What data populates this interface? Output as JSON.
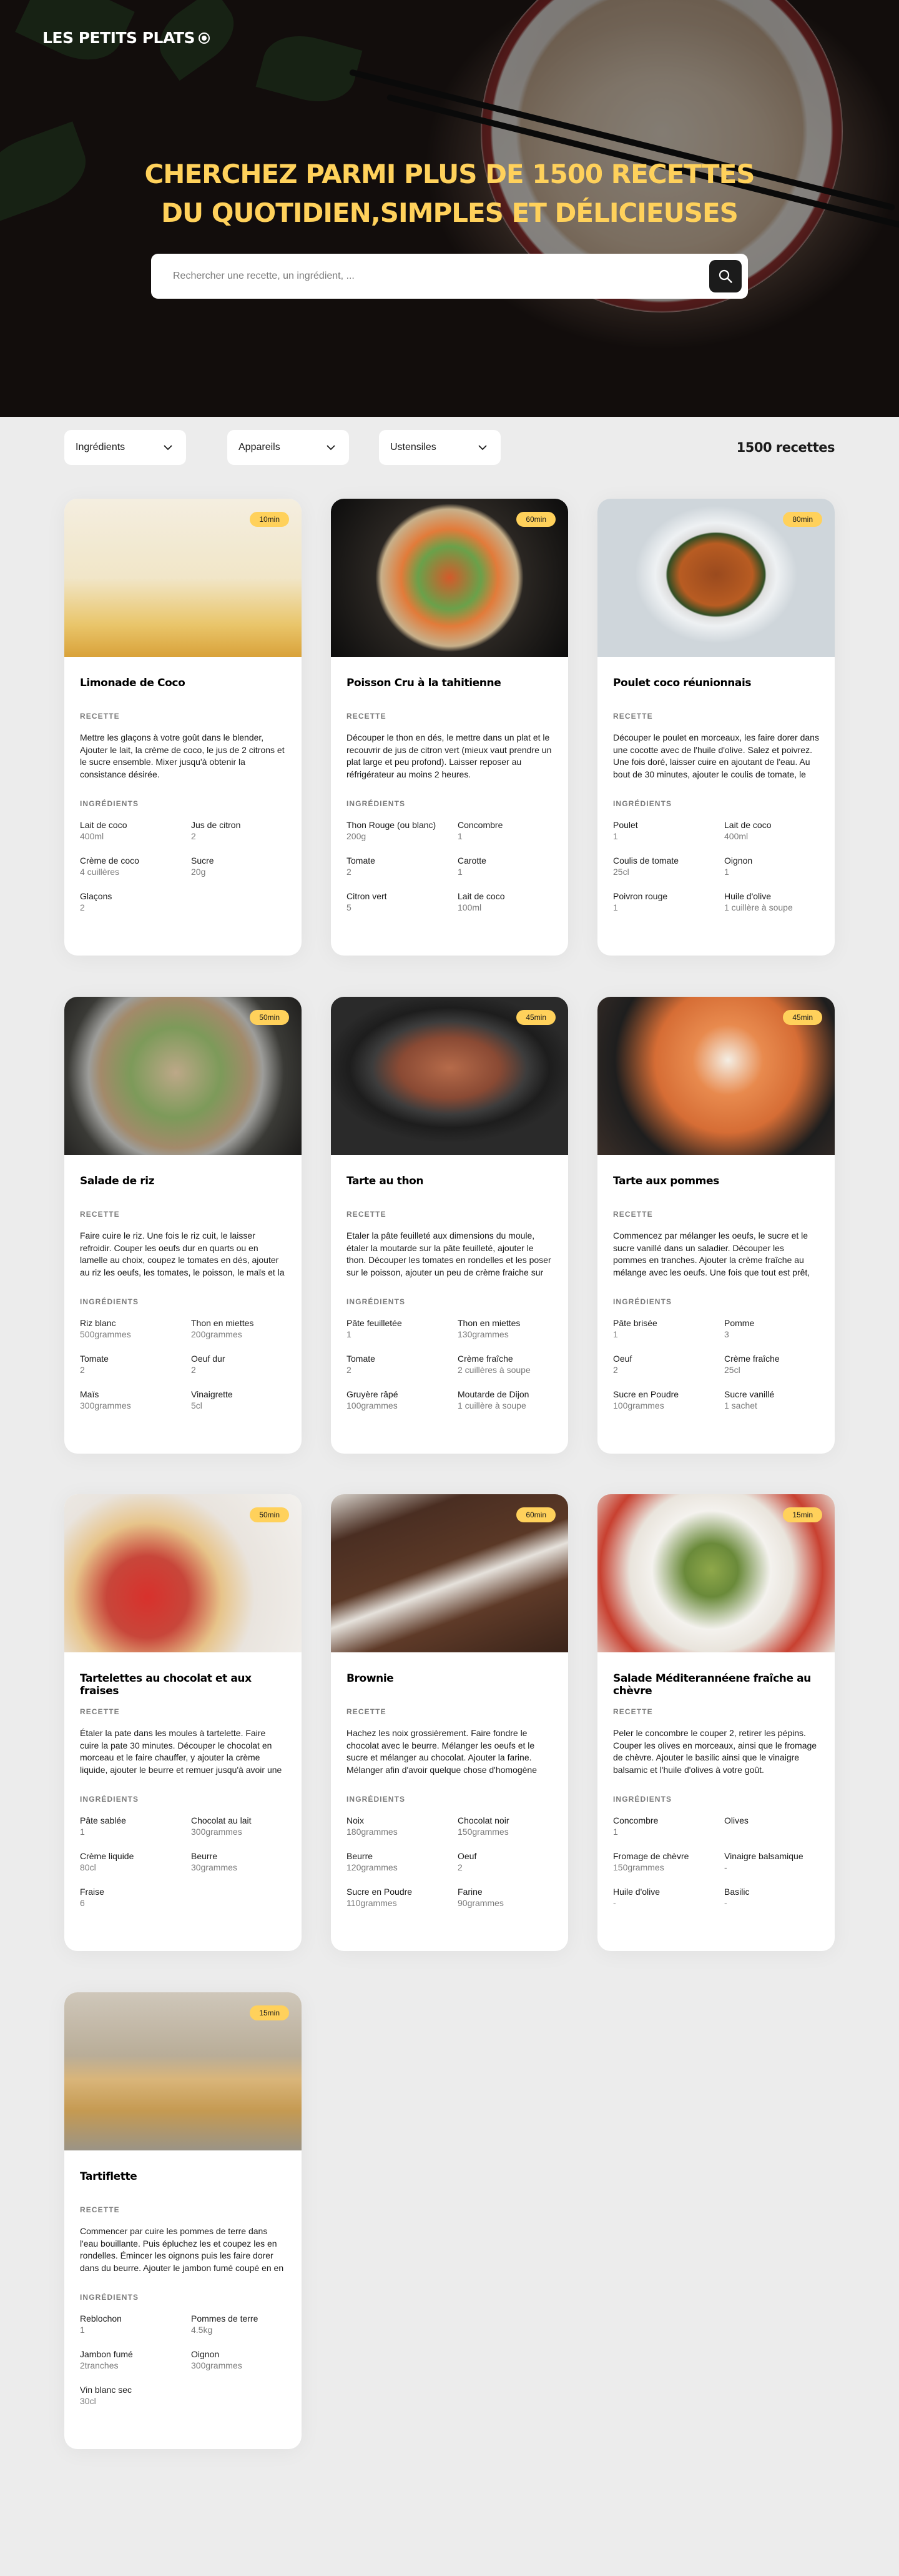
{
  "header": {
    "logo": "LES PETITS PLATS",
    "headline_1": "CHERCHEZ PARMI PLUS DE 1500 RECETTES",
    "headline_2": "DU QUOTIDIEN,SIMPLES ET DÉLICIEUSES",
    "search_placeholder": "Rechercher une recette, un ingrédient, ..."
  },
  "filters": {
    "ingredients": "Ingrédients",
    "appareils": "Appareils",
    "ustensiles": "Ustensiles",
    "count": "1500 recettes"
  },
  "labels": {
    "recette": "RECETTE",
    "ingredients": "INGRÉDIENTS"
  },
  "recipes": [
    {
      "time": "10min",
      "title": "Limonade de Coco",
      "description": "Mettre les glaçons à votre goût dans le blender, Ajouter le lait, la crème de coco, le jus de 2 citrons et le sucre ensemble. Mixer jusqu'à obtenir la consistance désirée.",
      "ingredients": [
        {
          "name": "Lait de coco",
          "qty": "400ml"
        },
        {
          "name": "Jus de citron",
          "qty": "2"
        },
        {
          "name": "Crème de coco",
          "qty": "4 cuillères"
        },
        {
          "name": "Sucre",
          "qty": "20g"
        },
        {
          "name": "Glaçons",
          "qty": "2"
        }
      ]
    },
    {
      "time": "60min",
      "title": "Poisson Cru à la tahitienne",
      "description": "Découper le thon en dés, le mettre dans un plat et le recouvrir de jus de citron vert (mieux vaut prendre un plat large et peu profond). Laisser reposer au réfrigérateur au moins 2 heures.",
      "ingredients": [
        {
          "name": "Thon Rouge (ou blanc)",
          "qty": "200g"
        },
        {
          "name": "Concombre",
          "qty": "1"
        },
        {
          "name": "Tomate",
          "qty": "2"
        },
        {
          "name": "Carotte",
          "qty": "1"
        },
        {
          "name": "Citron vert",
          "qty": "5"
        },
        {
          "name": "Lait de coco",
          "qty": "100ml"
        }
      ]
    },
    {
      "time": "80min",
      "title": "Poulet coco réunionnais",
      "description": "Découper le poulet en morceaux, les faire dorer dans une cocotte avec de l'huile d'olive. Salez et poivrez. Une fois doré, laisser cuire en ajoutant de l'eau. Au bout de 30 minutes, ajouter le coulis de tomate, le lait de coco ainsi que le poivron et l'oignon.",
      "ingredients": [
        {
          "name": "Poulet",
          "qty": "1"
        },
        {
          "name": "Lait de coco",
          "qty": "400ml"
        },
        {
          "name": "Coulis de tomate",
          "qty": "25cl"
        },
        {
          "name": "Oignon",
          "qty": "1"
        },
        {
          "name": "Poivron rouge",
          "qty": "1"
        },
        {
          "name": "Huile d'olive",
          "qty": "1 cuillère à soupe"
        }
      ]
    },
    {
      "time": "50min",
      "title": "Salade de riz",
      "description": "Faire cuire le riz. Une fois le riz cuit, le laisser refroidir. Couper les oeufs dur en quarts ou en lamelle au choix, coupez le tomates en dés, ajouter au riz les oeufs, les tomates, le poisson, le maïs et la vinaigrette.",
      "ingredients": [
        {
          "name": "Riz blanc",
          "qty": "500grammes"
        },
        {
          "name": "Thon en miettes",
          "qty": "200grammes"
        },
        {
          "name": "Tomate",
          "qty": "2"
        },
        {
          "name": "Oeuf dur",
          "qty": "2"
        },
        {
          "name": "Maïs",
          "qty": "300grammes"
        },
        {
          "name": "Vinaigrette",
          "qty": "5cl"
        }
      ]
    },
    {
      "time": "45min",
      "title": "Tarte au thon",
      "description": "Etaler la pâte feuilleté aux dimensions du moule, étaler la moutarde sur la pâte feuilleté, ajouter le thon. Découper les tomates en rondelles et les poser sur le poisson, ajouter un peu de crème fraiche sur toute la tarte et recouvrez de gruyère râpé.",
      "ingredients": [
        {
          "name": "Pâte feuilletée",
          "qty": "1"
        },
        {
          "name": "Thon en miettes",
          "qty": "130grammes"
        },
        {
          "name": "Tomate",
          "qty": "2"
        },
        {
          "name": "Crème fraîche",
          "qty": "2 cuillères à soupe"
        },
        {
          "name": "Gruyère râpé",
          "qty": "100grammes"
        },
        {
          "name": "Moutarde de Dijon",
          "qty": "1 cuillère à soupe"
        }
      ]
    },
    {
      "time": "45min",
      "title": "Tarte aux pommes",
      "description": "Commencez par mélanger les oeufs, le sucre et le sucre vanillé dans un saladier. Découper les pommes en tranches. Ajouter la crème fraîche au mélange avec les oeufs. Une fois que tout est prêt, étalez la tarte dans le moule.",
      "ingredients": [
        {
          "name": "Pâte brisée",
          "qty": "1"
        },
        {
          "name": "Pomme",
          "qty": "3"
        },
        {
          "name": "Oeuf",
          "qty": "2"
        },
        {
          "name": "Crème fraîche",
          "qty": "25cl"
        },
        {
          "name": "Sucre en Poudre",
          "qty": "100grammes"
        },
        {
          "name": "Sucre vanillé",
          "qty": "1 sachet"
        }
      ]
    },
    {
      "time": "50min",
      "title": "Tartelettes au chocolat et aux fraises",
      "description": "Étaler la pate dans les moules à tartelette. Faire cuire la pate 30 minutes. Découper le chocolat en morceau et le faire chauffer, y ajouter la crème liquide, ajouter le beurre et remuer jusqu'à avoir une pâte homogène.",
      "ingredients": [
        {
          "name": "Pâte sablée",
          "qty": "1"
        },
        {
          "name": "Chocolat au lait",
          "qty": "300grammes"
        },
        {
          "name": "Crème liquide",
          "qty": "80cl"
        },
        {
          "name": "Beurre",
          "qty": "30grammes"
        },
        {
          "name": "Fraise",
          "qty": "6"
        }
      ]
    },
    {
      "time": "60min",
      "title": "Brownie",
      "description": "Hachez les noix grossièrement. Faire fondre le chocolat avec le beurre. Mélanger les oeufs et le sucre et mélanger au chocolat. Ajouter la farine. Mélanger afin d'avoir quelque chose d'homogène puis incorporer les noix.",
      "ingredients": [
        {
          "name": "Noix",
          "qty": "180grammes"
        },
        {
          "name": "Chocolat noir",
          "qty": "150grammes"
        },
        {
          "name": "Beurre",
          "qty": "120grammes"
        },
        {
          "name": "Oeuf",
          "qty": "2"
        },
        {
          "name": "Sucre en Poudre",
          "qty": "110grammes"
        },
        {
          "name": "Farine",
          "qty": "90grammes"
        }
      ]
    },
    {
      "time": "15min",
      "title": "Salade Méditerannéene fraîche au chèvre",
      "description": "Peler le concombre le couper 2, retirer les pépins. Couper les olives en morceaux, ainsi que le fromage de chèvre. Ajouter le basilic ainsi que le vinaigre balsamic et l'huile d'olives à votre goût.",
      "ingredients": [
        {
          "name": "Concombre",
          "qty": "1"
        },
        {
          "name": "Olives",
          "qty": ""
        },
        {
          "name": "Fromage de chèvre",
          "qty": "150grammes"
        },
        {
          "name": "Vinaigre balsamique",
          "qty": "-"
        },
        {
          "name": "Huile d'olive",
          "qty": "-"
        },
        {
          "name": "Basilic",
          "qty": "-"
        }
      ]
    },
    {
      "time": "15min",
      "title": "Tartiflette",
      "description": "Commencer par cuire les pommes de terre dans l'eau bouillante. Puis épluchez les et coupez les en rondelles. Émincer les oignons puis les faire dorer dans du beurre. Ajouter le jambon fumé coupé en en morceaux ainsi que les pommes de terres.",
      "ingredients": [
        {
          "name": "Reblochon",
          "qty": "1"
        },
        {
          "name": "Pommes de terre",
          "qty": "4.5kg"
        },
        {
          "name": "Jambon fumé",
          "qty": "2tranches"
        },
        {
          "name": "Oignon",
          "qty": "300grammes"
        },
        {
          "name": "Vin blanc sec",
          "qty": "30cl"
        }
      ]
    }
  ]
}
